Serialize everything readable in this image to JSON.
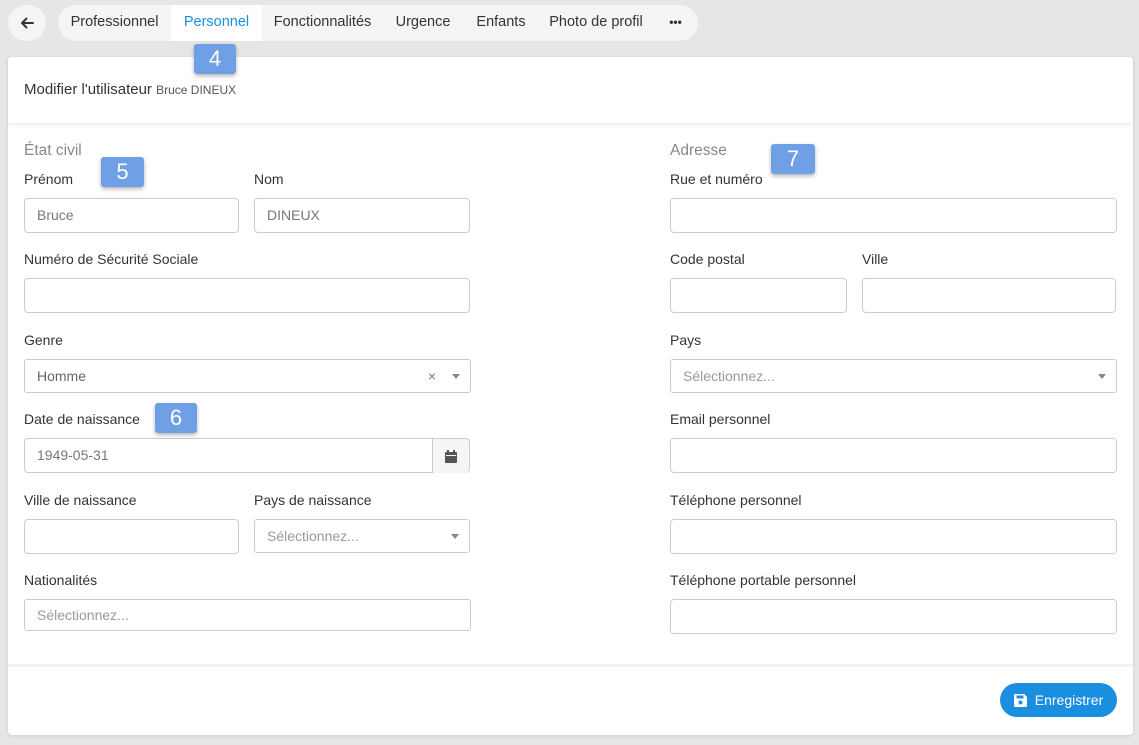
{
  "nav": {
    "back_icon": "arrow-left-icon",
    "tabs": [
      {
        "label": "Professionnel"
      },
      {
        "label": "Personnel"
      },
      {
        "label": "Fonctionnalités"
      },
      {
        "label": "Urgence"
      },
      {
        "label": "Enfants"
      },
      {
        "label": "Photo de profil"
      },
      {
        "label": "•••"
      }
    ],
    "active_tab": "Personnel"
  },
  "badges": [
    "4",
    "5",
    "6",
    "7"
  ],
  "header": {
    "title": "Modifier l'utilisateur",
    "subtitle": "Bruce DINEUX"
  },
  "etat_civil": {
    "title": "État civil",
    "prenom": {
      "label": "Prénom",
      "value": "Bruce"
    },
    "nom": {
      "label": "Nom",
      "value": "DINEUX"
    },
    "nss": {
      "label": "Numéro de Sécurité Sociale",
      "value": ""
    },
    "genre": {
      "label": "Genre",
      "value": "Homme",
      "clear": "×"
    },
    "date_naissance": {
      "label": "Date de naissance",
      "value": "1949-05-31"
    },
    "ville_naissance": {
      "label": "Ville de naissance",
      "value": ""
    },
    "pays_naissance": {
      "label": "Pays de naissance",
      "placeholder": "Sélectionnez..."
    },
    "nationalites": {
      "label": "Nationalités",
      "placeholder": "Sélectionnez..."
    }
  },
  "adresse": {
    "title": "Adresse",
    "rue": {
      "label": "Rue et numéro",
      "value": ""
    },
    "code_postal": {
      "label": "Code postal",
      "value": ""
    },
    "ville": {
      "label": "Ville",
      "value": ""
    },
    "pays": {
      "label": "Pays",
      "placeholder": "Sélectionnez..."
    },
    "email": {
      "label": "Email personnel",
      "value": ""
    },
    "tel": {
      "label": "Téléphone personnel",
      "value": ""
    },
    "mobile": {
      "label": "Téléphone portable personnel",
      "value": ""
    }
  },
  "footer": {
    "save_label": "Enregistrer",
    "save_icon": "floppy-disk-icon"
  },
  "colors": {
    "accent": "#1a8fe0",
    "badge": "#6fa0e6",
    "background": "#e6e6e6"
  }
}
